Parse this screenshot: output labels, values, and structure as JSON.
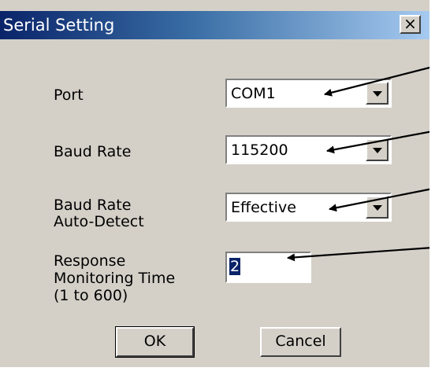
{
  "window": {
    "title": "Serial Setting",
    "close_glyph": "×"
  },
  "fields": {
    "port": {
      "label": "Port",
      "value": "COM1"
    },
    "baud_rate": {
      "label": "Baud Rate",
      "value": "115200"
    },
    "auto_detect": {
      "label_line1": "Baud Rate",
      "label_line2": "Auto-Detect",
      "value": "Effective"
    },
    "response_time": {
      "label_line1": "Response",
      "label_line2": "Monitoring Time",
      "label_line3": "(1 to 600)",
      "value": "2"
    }
  },
  "buttons": {
    "ok_label": "OK",
    "cancel_label": "Cancel"
  },
  "colors": {
    "dialog_face": "#d4d0c8",
    "title_gradient_start": "#0a246a",
    "title_gradient_end": "#a6caf0",
    "selection": "#0a246a"
  },
  "icons": {
    "close": "close-icon",
    "dropdown": "chevron-down-icon"
  }
}
